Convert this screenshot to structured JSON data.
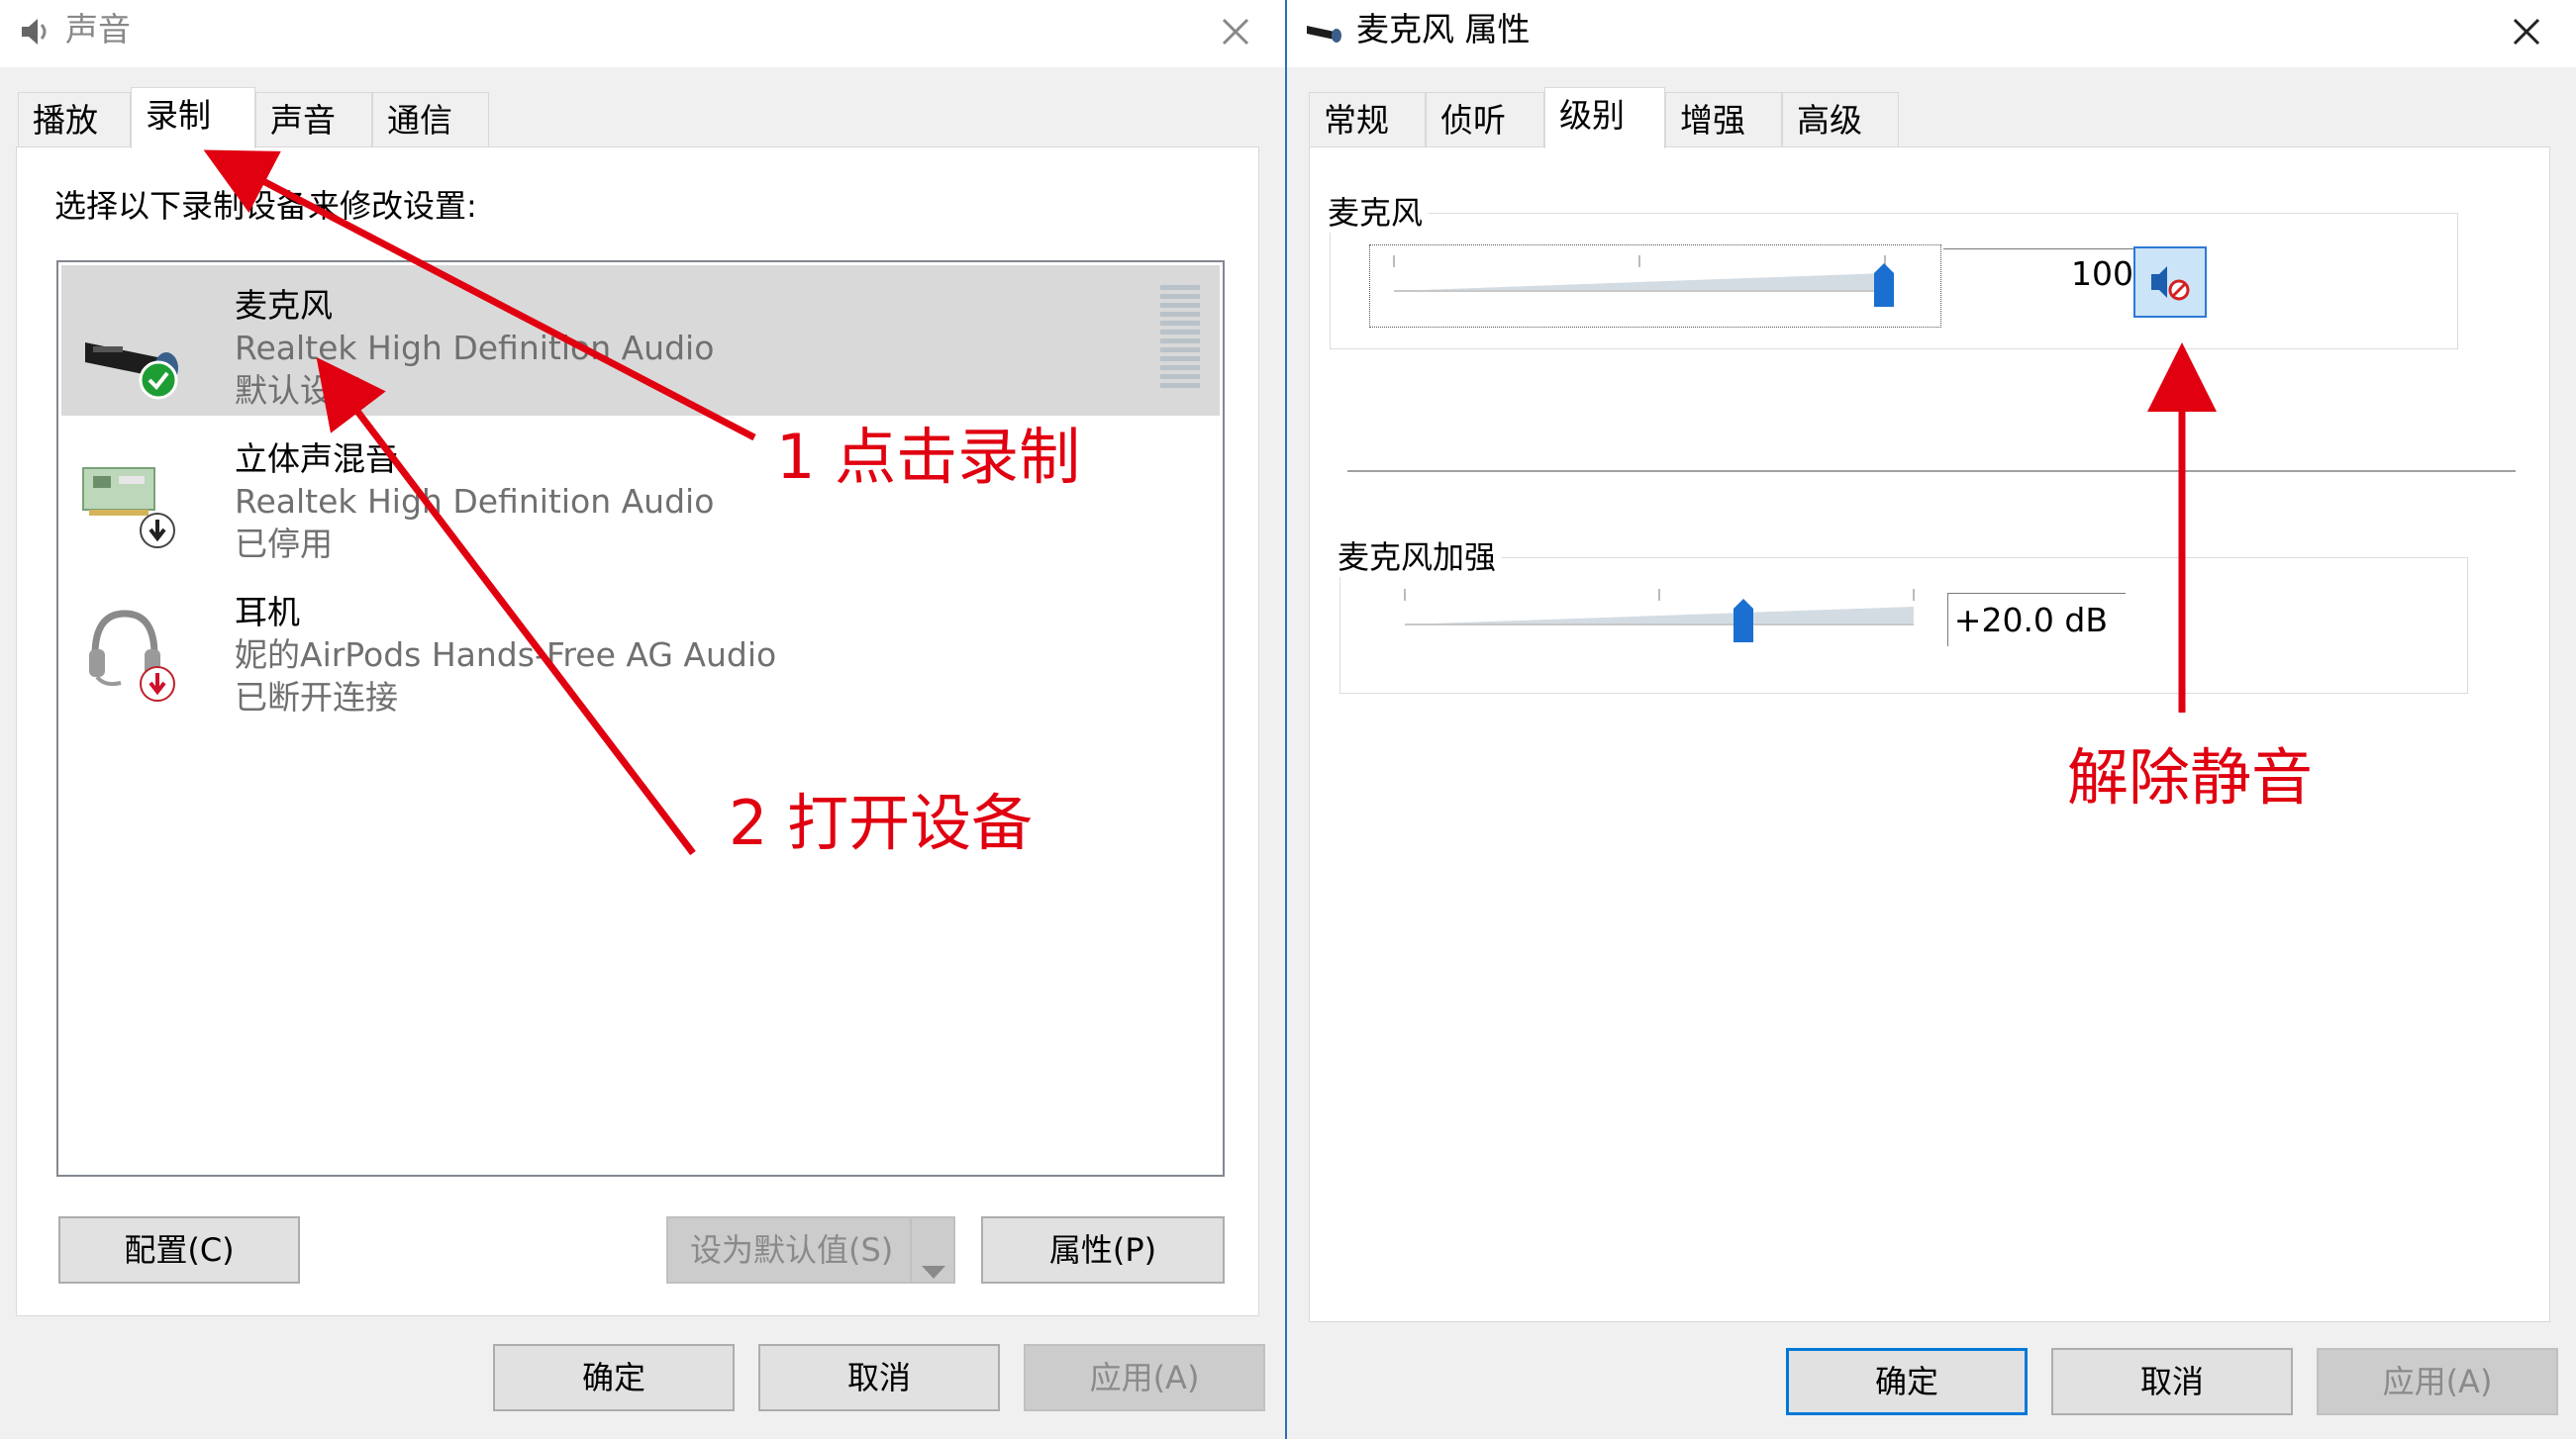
{
  "left_dialog": {
    "title": "声音",
    "icon": "speaker-icon",
    "tabs": [
      {
        "label": "播放"
      },
      {
        "label": "录制",
        "active": true
      },
      {
        "label": "声音"
      },
      {
        "label": "通信"
      }
    ],
    "instruction": "选择以下录制设备来修改设置:",
    "devices": [
      {
        "name": "麦克风",
        "driver": "Realtek High Definition Audio",
        "status": "默认设备",
        "icon": "microphone-icon",
        "badge": "check-icon",
        "selected": true
      },
      {
        "name": "立体声混音",
        "driver": "Realtek High Definition Audio",
        "status": "已停用",
        "icon": "sound-card-icon",
        "badge": "down-arrow-icon"
      },
      {
        "name": "耳机",
        "driver": "妮的AirPods Hands-Free AG Audio",
        "status": "已断开连接",
        "icon": "headset-icon",
        "badge": "red-down-arrow-icon"
      }
    ],
    "buttons": {
      "configure": "配置(C)",
      "set_default": "设为默认值(S)",
      "properties": "属性(P)",
      "ok": "确定",
      "cancel": "取消",
      "apply": "应用(A)"
    }
  },
  "right_dialog": {
    "title": "麦克风 属性",
    "icon": "microphone-icon",
    "tabs": [
      {
        "label": "常规"
      },
      {
        "label": "侦听"
      },
      {
        "label": "级别",
        "active": true
      },
      {
        "label": "增强"
      },
      {
        "label": "高级"
      }
    ],
    "microphone_group": {
      "label": "麦克风",
      "value": "100",
      "level": 1.0,
      "mute_icon": "speaker-muted-icon"
    },
    "boost_group": {
      "label": "麦克风加强",
      "value": "+20.0 dB",
      "level": 0.67
    },
    "buttons": {
      "ok": "确定",
      "cancel": "取消",
      "apply": "应用(A)"
    }
  },
  "annotations": {
    "step1": "1 点击录制",
    "step2": "2 打开设备",
    "unmute": "解除静音",
    "color": "#e00010"
  }
}
